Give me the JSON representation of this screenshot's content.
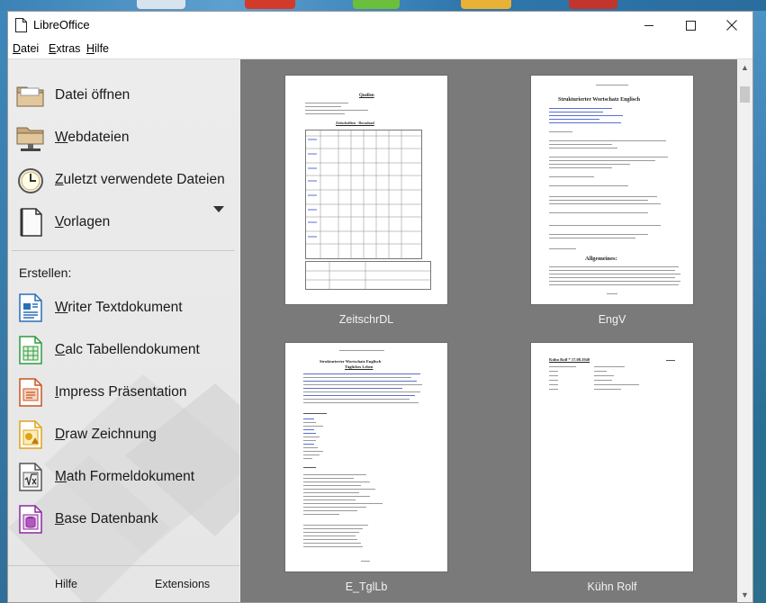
{
  "window": {
    "title": "LibreOffice",
    "controls": {
      "minimize": "—",
      "maximize": "☐",
      "close": "✕"
    }
  },
  "menu": [
    {
      "label": "Datei",
      "accel": "D",
      "rest": "atei"
    },
    {
      "label": "Extras",
      "accel": "E",
      "rest": "xtras"
    },
    {
      "label": "Hilfe",
      "accel": "H",
      "rest": "ilfe"
    }
  ],
  "sidebar": {
    "open": {
      "accel": "",
      "label": "Datei öffnen"
    },
    "web": {
      "accel": "W",
      "rest": "ebdateien"
    },
    "recent": {
      "accel": "Z",
      "rest": "uletzt verwendete Dateien"
    },
    "templates": {
      "accel": "V",
      "rest": "orlagen"
    },
    "create_heading": "Erstellen:",
    "writer": {
      "accel": "W",
      "rest": "riter Textdokument"
    },
    "calc": {
      "accel": "C",
      "rest": "alc Tabellendokument"
    },
    "impress": {
      "accel": "I",
      "rest": "mpress Präsentation"
    },
    "draw": {
      "accel": "D",
      "rest": "raw Zeichnung"
    },
    "math": {
      "accel": "M",
      "rest": "ath Formeldokument"
    },
    "base": {
      "accel": "B",
      "rest": "ase Datenbank"
    },
    "help_button": "Hilfe",
    "extensions_button": "Extensions"
  },
  "recent_files": [
    {
      "name": "ZeitschrDL"
    },
    {
      "name": "EngV"
    },
    {
      "name": "E_TglLb"
    },
    {
      "name": "Kühn Rolf"
    }
  ],
  "thumb_text": {
    "zeit_title": "Quellen",
    "zeit_sub": "Zeitschriften - Download",
    "engv_title": "Strukturierter Wortschatz Englisch",
    "engv_sub": "Allgemeines:",
    "etgl_title": "Strukturierter Wortschatz Englisch",
    "etgl_sub": "Tägliches Leben",
    "kuehn_title": "Kühn Rolf * 17.08.1940"
  },
  "colors": {
    "writer": "#2a6fb8",
    "calc": "#2f9a3e",
    "impress": "#c8541e",
    "draw": "#e0a316",
    "math": "#555555",
    "base": "#8a2a9b"
  }
}
